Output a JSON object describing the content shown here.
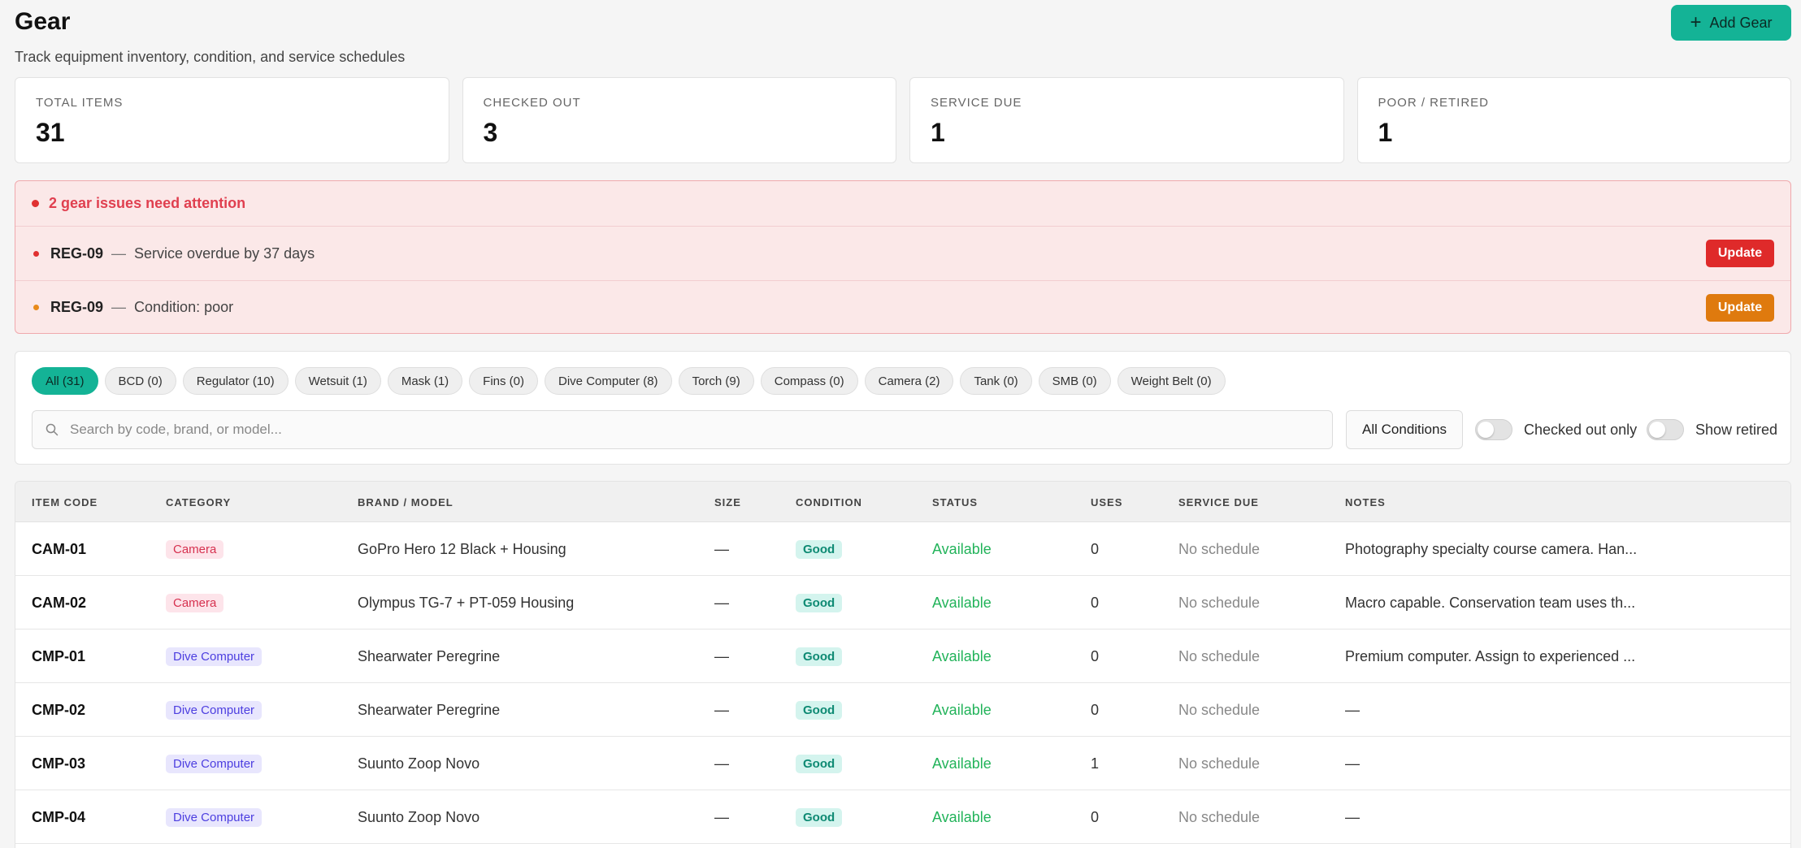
{
  "header": {
    "title": "Gear",
    "subtitle": "Track equipment inventory, condition, and service schedules",
    "add_button": "Add Gear"
  },
  "stats": [
    {
      "label": "TOTAL ITEMS",
      "value": "31"
    },
    {
      "label": "CHECKED OUT",
      "value": "3"
    },
    {
      "label": "SERVICE DUE",
      "value": "1"
    },
    {
      "label": "POOR / RETIRED",
      "value": "1"
    }
  ],
  "alerts": {
    "title": "2 gear issues need attention",
    "items": [
      {
        "code": "REG-09",
        "separator": "—",
        "message": "Service overdue by 37 days",
        "action": "Update",
        "severity": "red"
      },
      {
        "code": "REG-09",
        "separator": "—",
        "message": "Condition: poor",
        "action": "Update",
        "severity": "orange"
      }
    ]
  },
  "filters": {
    "chips": [
      "All (31)",
      "BCD (0)",
      "Regulator (10)",
      "Wetsuit (1)",
      "Mask (1)",
      "Fins (0)",
      "Dive Computer (8)",
      "Torch (9)",
      "Compass (0)",
      "Camera (2)",
      "Tank (0)",
      "SMB (0)",
      "Weight Belt (0)"
    ],
    "active_chip": 0,
    "search_placeholder": "Search by code, brand, or model...",
    "condition_select": "All Conditions",
    "toggle_checked_out": "Checked out only",
    "toggle_show_retired": "Show retired"
  },
  "table": {
    "columns": [
      "ITEM CODE",
      "CATEGORY",
      "BRAND / MODEL",
      "SIZE",
      "CONDITION",
      "STATUS",
      "USES",
      "SERVICE DUE",
      "NOTES"
    ],
    "rows": [
      {
        "code": "CAM-01",
        "category": "Camera",
        "model": "GoPro Hero 12 Black + Housing",
        "size": "—",
        "condition": "Good",
        "status": "Available",
        "uses": "0",
        "service": "No schedule",
        "notes": "Photography specialty course camera. Han..."
      },
      {
        "code": "CAM-02",
        "category": "Camera",
        "model": "Olympus TG-7 + PT-059 Housing",
        "size": "—",
        "condition": "Good",
        "status": "Available",
        "uses": "0",
        "service": "No schedule",
        "notes": "Macro capable. Conservation team uses th..."
      },
      {
        "code": "CMP-01",
        "category": "Dive Computer",
        "model": "Shearwater Peregrine",
        "size": "—",
        "condition": "Good",
        "status": "Available",
        "uses": "0",
        "service": "No schedule",
        "notes": "Premium computer. Assign to experienced ..."
      },
      {
        "code": "CMP-02",
        "category": "Dive Computer",
        "model": "Shearwater Peregrine",
        "size": "—",
        "condition": "Good",
        "status": "Available",
        "uses": "0",
        "service": "No schedule",
        "notes": "—"
      },
      {
        "code": "CMP-03",
        "category": "Dive Computer",
        "model": "Suunto Zoop Novo",
        "size": "—",
        "condition": "Good",
        "status": "Available",
        "uses": "1",
        "service": "No schedule",
        "notes": "—"
      },
      {
        "code": "CMP-04",
        "category": "Dive Computer",
        "model": "Suunto Zoop Novo",
        "size": "—",
        "condition": "Good",
        "status": "Available",
        "uses": "0",
        "service": "No schedule",
        "notes": "—"
      }
    ]
  }
}
